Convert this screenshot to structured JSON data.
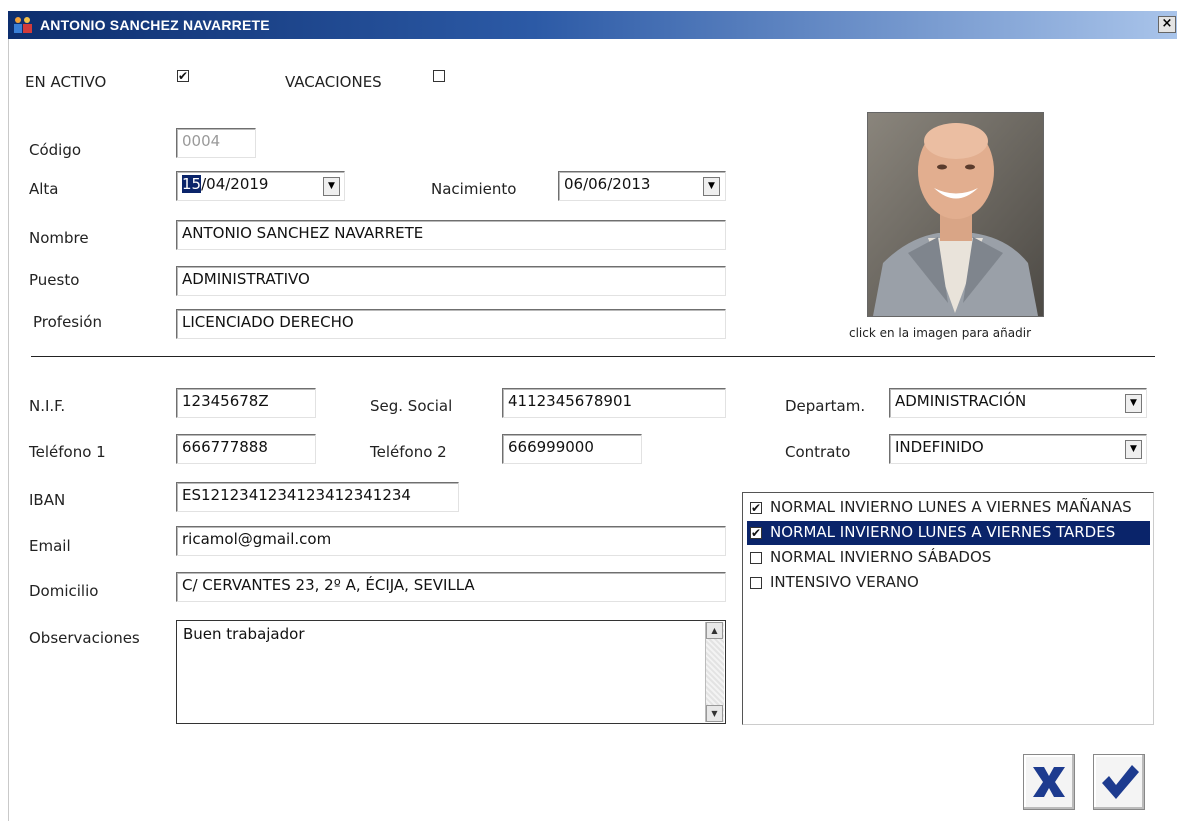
{
  "window": {
    "title": "ANTONIO SANCHEZ NAVARRETE",
    "icon": "users-icon",
    "close_symbol": "×"
  },
  "status": {
    "en_activo_label": "EN ACTIVO",
    "en_activo_checked": true,
    "vacaciones_label": "VACACIONES",
    "vacaciones_checked": false
  },
  "form": {
    "codigo_label": "Código",
    "codigo_value": "0004",
    "alta_label": "Alta",
    "alta_value_day": "15",
    "alta_value_rest": "/04/2019",
    "nacimiento_label": "Nacimiento",
    "nacimiento_value": "06/06/2013",
    "nombre_label": "Nombre",
    "nombre_value": "ANTONIO SANCHEZ NAVARRETE",
    "puesto_label": "Puesto",
    "puesto_value": "ADMINISTRATIVO",
    "profesion_label": "Profesión",
    "profesion_value": "LICENCIADO DERECHO",
    "nif_label": "N.I.F.",
    "nif_value": "12345678Z",
    "seg_social_label": "Seg. Social",
    "seg_social_value": "4112345678901",
    "departam_label": "Departam.",
    "departam_value": "ADMINISTRACIÓN",
    "telefono1_label": "Teléfono 1",
    "telefono1_value": "666777888",
    "telefono2_label": "Teléfono 2",
    "telefono2_value": "666999000",
    "contrato_label": "Contrato",
    "contrato_value": "INDEFINIDO",
    "iban_label": "IBAN",
    "iban_value": "ES1212341234123412341234",
    "email_label": "Email",
    "email_value": "ricamol@gmail.com",
    "domicilio_label": "Domicilio",
    "domicilio_value": "C/ CERVANTES 23, 2º A, ÉCIJA, SEVILLA",
    "observaciones_label": "Observaciones",
    "observaciones_value": "Buen trabajador"
  },
  "photo": {
    "caption": "click en la imagen para añadir"
  },
  "horarios": [
    {
      "label": "NORMAL INVIERNO LUNES A VIERNES MAÑANAS",
      "checked": true,
      "selected": false
    },
    {
      "label": "NORMAL INVIERNO LUNES A VIERNES TARDES",
      "checked": true,
      "selected": true
    },
    {
      "label": "NORMAL INVIERNO SÁBADOS",
      "checked": false,
      "selected": false
    },
    {
      "label": "INTENSIVO VERANO",
      "checked": false,
      "selected": false
    }
  ],
  "actions": {
    "cancel_icon": "x-cancel-icon",
    "accept_icon": "checkmark-accept-icon"
  },
  "colors": {
    "selection": "#0a246a",
    "button_icon": "#1d3b8f"
  }
}
